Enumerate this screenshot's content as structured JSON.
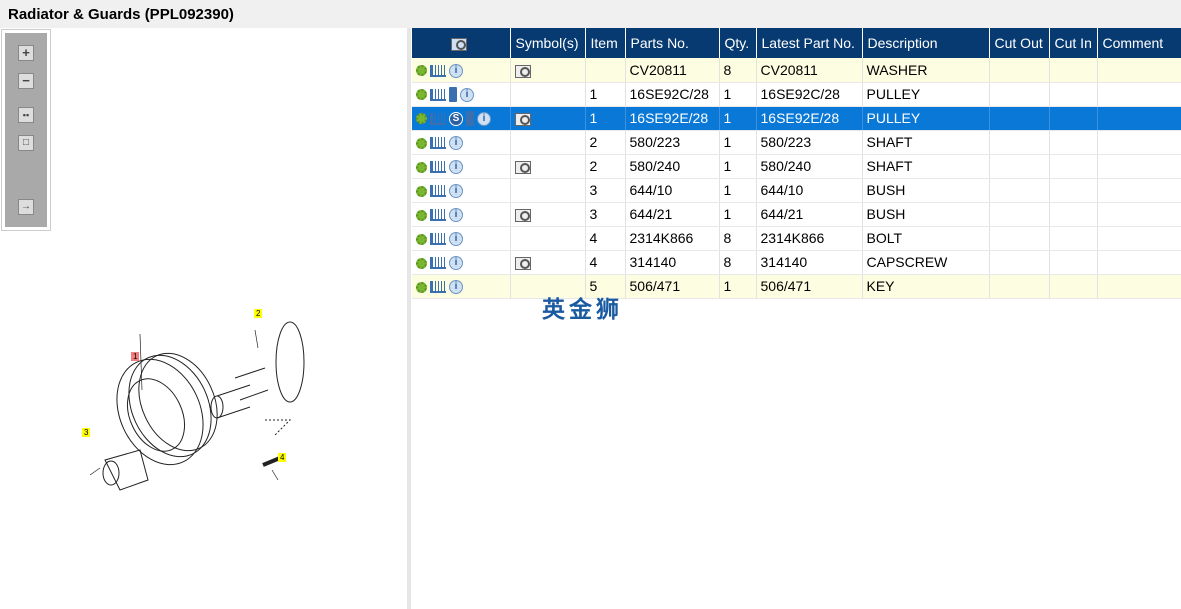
{
  "title": "Radiator & Guards (PPL092390)",
  "toolbar": [
    "zoom-in",
    "zoom-out",
    "fit-all",
    "fit-window",
    "toggle-list"
  ],
  "diagram": {
    "callouts": [
      "1",
      "2",
      "3",
      "4"
    ]
  },
  "grid": {
    "columns": [
      "",
      "Symbol(s)",
      "Item",
      "Parts No.",
      "Qty.",
      "Latest Part No.",
      "Description",
      "Cut Out",
      "Cut In",
      "Comment"
    ],
    "rows": [
      {
        "icons": [
          "gear",
          "cart",
          "info"
        ],
        "symbol": true,
        "item": "",
        "part": "CV20811",
        "qty": "8",
        "latest": "CV20811",
        "desc": "WASHER",
        "state": "highlight"
      },
      {
        "icons": [
          "gear",
          "cart",
          "book",
          "info"
        ],
        "symbol": false,
        "item": "1",
        "part": "16SE92C/28",
        "qty": "1",
        "latest": "16SE92C/28",
        "desc": "PULLEY",
        "state": ""
      },
      {
        "icons": [
          "gear",
          "cart",
          "s",
          "book",
          "info"
        ],
        "symbol": true,
        "item": "1",
        "part": "16SE92E/28",
        "qty": "1",
        "latest": "16SE92E/28",
        "desc": "PULLEY",
        "state": "selected"
      },
      {
        "icons": [
          "gear",
          "cart",
          "info"
        ],
        "symbol": false,
        "item": "2",
        "part": "580/223",
        "qty": "1",
        "latest": "580/223",
        "desc": "SHAFT",
        "state": ""
      },
      {
        "icons": [
          "gear",
          "cart",
          "info"
        ],
        "symbol": true,
        "item": "2",
        "part": "580/240",
        "qty": "1",
        "latest": "580/240",
        "desc": "SHAFT",
        "state": ""
      },
      {
        "icons": [
          "gear",
          "cart",
          "info"
        ],
        "symbol": false,
        "item": "3",
        "part": "644/10",
        "qty": "1",
        "latest": "644/10",
        "desc": "BUSH",
        "state": ""
      },
      {
        "icons": [
          "gear",
          "cart",
          "info"
        ],
        "symbol": true,
        "item": "3",
        "part": "644/21",
        "qty": "1",
        "latest": "644/21",
        "desc": "BUSH",
        "state": ""
      },
      {
        "icons": [
          "gear",
          "cart",
          "info"
        ],
        "symbol": false,
        "item": "4",
        "part": "2314K866",
        "qty": "8",
        "latest": "2314K866",
        "desc": "BOLT",
        "state": ""
      },
      {
        "icons": [
          "gear",
          "cart",
          "info"
        ],
        "symbol": true,
        "item": "4",
        "part": "314140",
        "qty": "8",
        "latest": "314140",
        "desc": "CAPSCREW",
        "state": ""
      },
      {
        "icons": [
          "gear",
          "cart",
          "info"
        ],
        "symbol": false,
        "item": "5",
        "part": "506/471",
        "qty": "1",
        "latest": "506/471",
        "desc": "KEY",
        "state": "highlight"
      }
    ]
  },
  "watermark": "英金狮"
}
